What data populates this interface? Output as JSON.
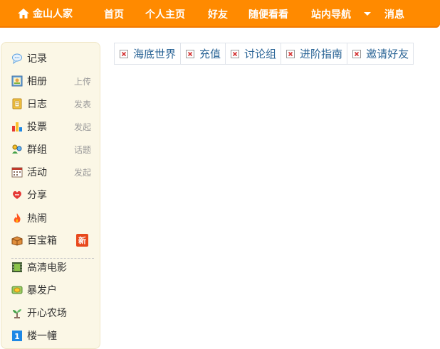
{
  "brand": {
    "name": "金山人家",
    "icon": "home-icon"
  },
  "nav": [
    "首页",
    "个人主页",
    "好友",
    "随便看看",
    "站内导航",
    "消息"
  ],
  "sidebar": {
    "items": [
      {
        "label": "记录",
        "action": "",
        "icon": "speech-bubble-icon"
      },
      {
        "label": "相册",
        "action": "上传",
        "icon": "photo-album-icon"
      },
      {
        "label": "日志",
        "action": "发表",
        "icon": "notebook-icon"
      },
      {
        "label": "投票",
        "action": "发起",
        "icon": "bar-chart-icon"
      },
      {
        "label": "群组",
        "action": "话题",
        "icon": "group-icon"
      },
      {
        "label": "活动",
        "action": "发起",
        "icon": "calendar-icon"
      },
      {
        "label": "分享",
        "action": "",
        "icon": "heart-share-icon"
      },
      {
        "label": "热闹",
        "action": "",
        "icon": "fire-icon"
      },
      {
        "label": "百宝箱",
        "badge": "新",
        "icon": "treasure-box-icon"
      }
    ],
    "apps": [
      {
        "label": "高清电影",
        "icon": "film-icon"
      },
      {
        "label": "暴发户",
        "icon": "money-icon"
      },
      {
        "label": "开心农场",
        "icon": "sprout-icon"
      },
      {
        "label": "楼一幢",
        "icon": "building-icon"
      }
    ]
  },
  "tabs": [
    {
      "label": "海底世界"
    },
    {
      "label": "充值"
    },
    {
      "label": "讨论组"
    },
    {
      "label": "进阶指南"
    },
    {
      "label": "邀请好友"
    }
  ],
  "colors": {
    "topbar": "#ff8a00",
    "sidebar_bg": "#fbf7e6",
    "tab_text": "#2a6496",
    "badge": "#e8481c"
  }
}
